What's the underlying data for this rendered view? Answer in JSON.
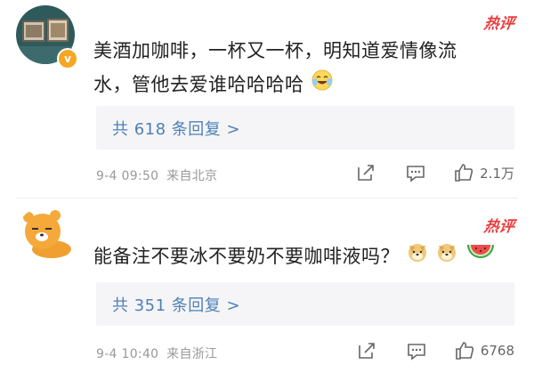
{
  "comments": [
    {
      "hot_label": "热评",
      "text_line1": "美酒加咖啡，一杯又一杯，明知道爱情像流",
      "text_line2": "水，管他去爱谁哈哈哈哈",
      "reply_link": "共 618 条回复 >",
      "timestamp": "9-4 09:50",
      "location": "来自北京",
      "likes": "2.1万"
    },
    {
      "hot_label": "热评",
      "text": "能备注不要冰不要奶不要咖啡液吗？",
      "reply_link": "共 351 条回复 >",
      "timestamp": "9-4 10:40",
      "location": "来自浙江",
      "likes": "6768"
    }
  ],
  "colors": {
    "hot": "#e83e3e",
    "link": "#4e80b6",
    "reply_bg": "#f5f5f7",
    "meta": "#999999",
    "verified_badge": "#f5a623"
  },
  "icons": [
    "verified-badge-icon",
    "share-icon",
    "comment-icon",
    "like-icon",
    "laughing-face-emoji",
    "doge-emoji",
    "watermelon-emoji"
  ]
}
